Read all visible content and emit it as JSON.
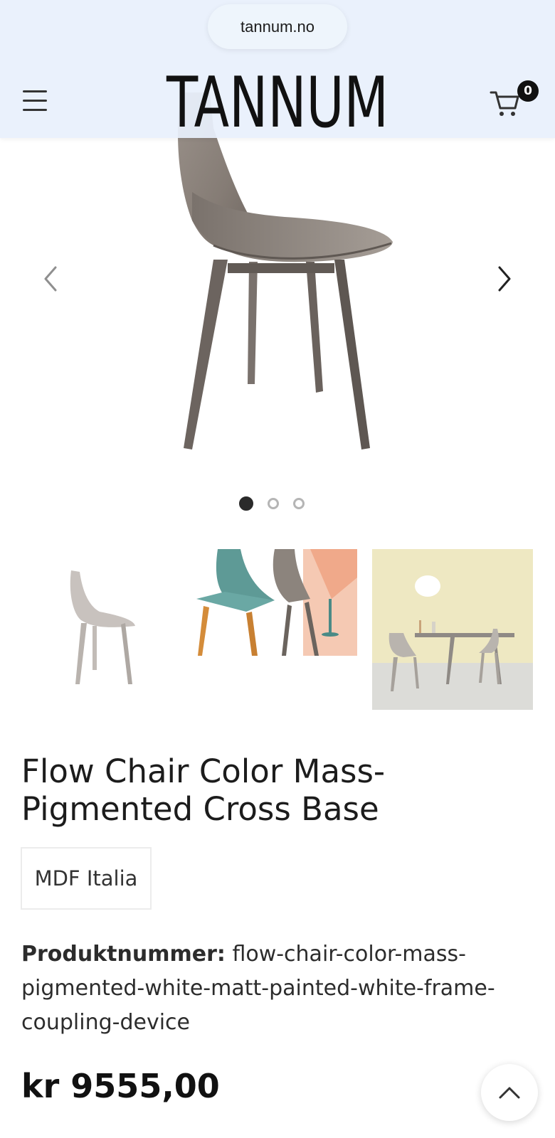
{
  "browser": {
    "url": "tannum.no"
  },
  "header": {
    "logo_text": "TANNUM",
    "cart_count": "0",
    "menu_icon": "hamburger-icon",
    "cart_icon": "cart-icon"
  },
  "gallery": {
    "active_slide": 1,
    "slide_count": 3,
    "prev_icon": "chevron-left-icon",
    "next_icon": "chevron-right-icon"
  },
  "product": {
    "title": "Flow Chair Color Mass-Pigmented Cross Base",
    "brand": "MDF Italia",
    "sku_label": "Produktnummer:",
    "sku_value": "flow-chair-color-mass-pigmented-white-matt-painted-white-frame-coupling-device",
    "price": "kr 9555,00"
  },
  "colors": {
    "header_bg": "#e8f0fc",
    "text": "#1c1c1c",
    "chair": "#8a817b"
  }
}
